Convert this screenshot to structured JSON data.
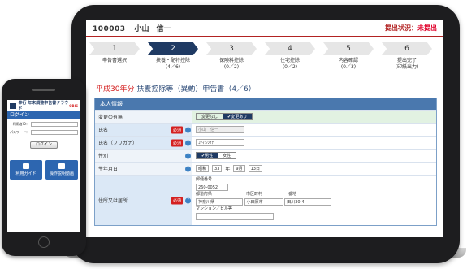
{
  "laptop": {
    "employee_id": "100003",
    "employee_name": "小山　信一",
    "status_label": "提出状況：",
    "status_value": "未提出",
    "steps": [
      {
        "num": "1",
        "label": "申告書選択",
        "count": ""
      },
      {
        "num": "2",
        "label": "扶養・配特控除",
        "count": "(4／6)"
      },
      {
        "num": "3",
        "label": "保険料控除",
        "count": "(0／2)"
      },
      {
        "num": "4",
        "label": "住宅控除",
        "count": "(0／2)"
      },
      {
        "num": "5",
        "label": "内容確認",
        "count": "(0／3)"
      },
      {
        "num": "6",
        "label": "提出完了",
        "count": "(印紙出力)"
      }
    ],
    "form_title_year": "平成30年分",
    "form_title_rest": "扶養控除等（異動）申告書（4／6）",
    "panel_title": "本人情報",
    "rows": {
      "change_label": "変更の有無",
      "change_off": "変更なし",
      "change_on": "✔変更あり",
      "name_label": "氏名",
      "name_value": "小山　信一",
      "kana_label": "氏名（フリガナ）",
      "kana_value": "ｺﾔﾏ ｼﾝｲﾁ",
      "sex_label": "性別",
      "sex_male": "✔男性",
      "sex_female": "女性",
      "birth_label": "生年月日",
      "birth_era": "昭和",
      "birth_year": "33",
      "birth_year_unit": "年",
      "birth_month": "9月",
      "birth_day": "13日",
      "addr_label": "住所又は居所",
      "postal_label": "郵便番号",
      "postal_value": "260-0052",
      "pref_label": "都道府県",
      "city_label": "市区町村",
      "street_label": "番地",
      "pref_value": "神奈川県",
      "city_value": "小田原市",
      "street_value": "田川30-4",
      "building_label": "マンション／ビル等"
    },
    "required_badge": "必須",
    "help_mark": "?"
  },
  "phone": {
    "brand": "奉行 年末調整申告書クラウド",
    "brand_tag": "OBIC",
    "login_header": "ログイン",
    "user_id_label": "利用者ID：",
    "password_label": "パスワード：",
    "login_button": "ログイン",
    "guide_button": "利用ガイド",
    "video_button": "操作説明動画"
  }
}
